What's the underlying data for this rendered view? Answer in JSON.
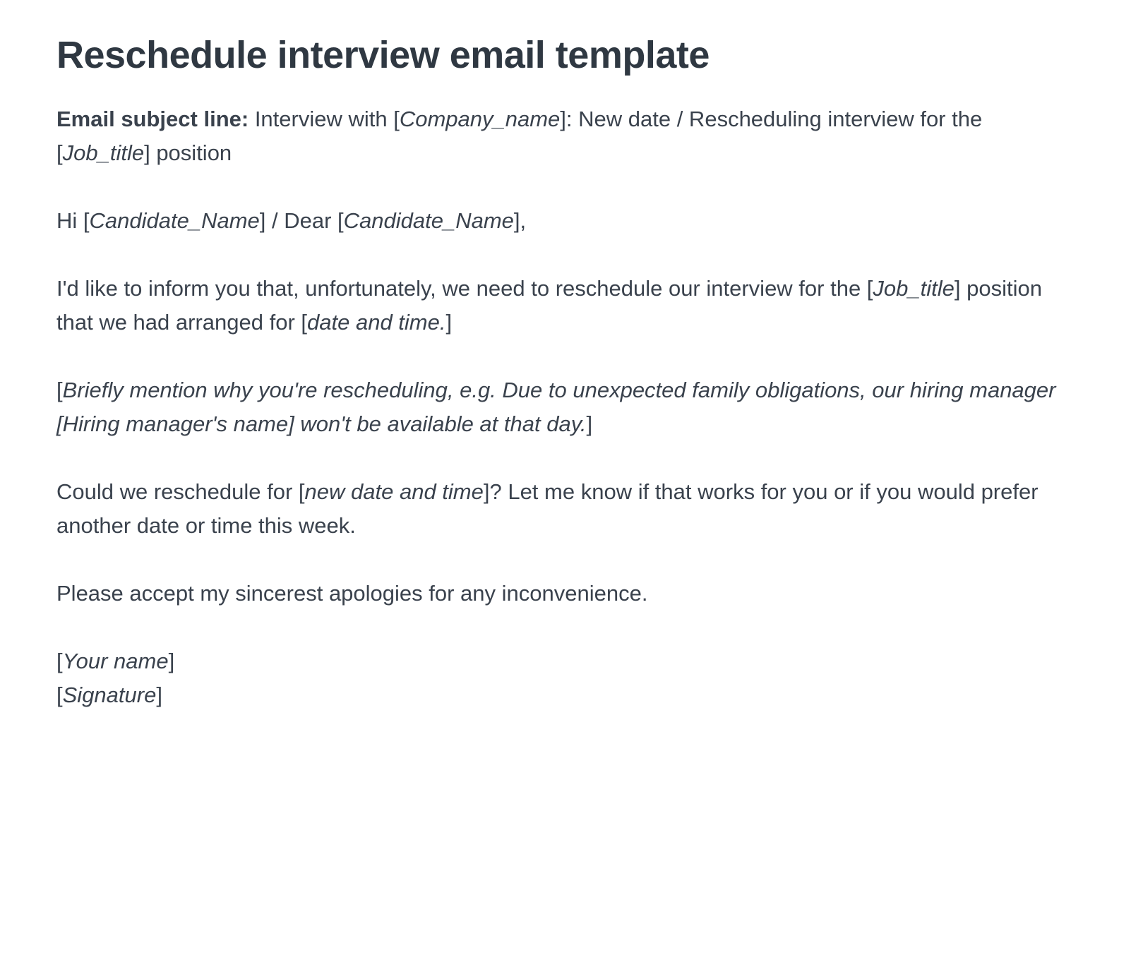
{
  "title": "Reschedule interview email template",
  "subject": {
    "label": "Email subject line:",
    "pre": " Interview with [",
    "ph1": "Company_name",
    "mid": "]: New date / Rescheduling interview for the [",
    "ph2": "Job_title",
    "post": "] position"
  },
  "greeting": {
    "pre": "Hi [",
    "ph1": "Candidate_Name",
    "mid": "] / Dear [",
    "ph2": "Candidate_Name",
    "post": "],"
  },
  "para1": {
    "pre": "I'd like to inform you that, unfortunately, we need to reschedule our interview for the [",
    "ph1": "Job_title",
    "mid": "] position that we had arranged for [",
    "ph2": "date and time.",
    "post": "]"
  },
  "para2": {
    "pre": "[",
    "body": "Briefly mention why you're rescheduling, e.g. Due to unexpected family obligations, our hiring manager [Hiring manager's name] won't be available at that day.",
    "post": "]"
  },
  "para3": {
    "pre": "Could we reschedule for [",
    "ph1": "new date and time",
    "post": "]? Let me know if that works for you or if you would prefer another date or time this week."
  },
  "para4": "Please accept my sincerest apologies for any inconvenience.",
  "sig": {
    "l1pre": "[",
    "l1": "Your name",
    "l1post": "]",
    "l2pre": "[",
    "l2": "Signature",
    "l2post": "]"
  }
}
